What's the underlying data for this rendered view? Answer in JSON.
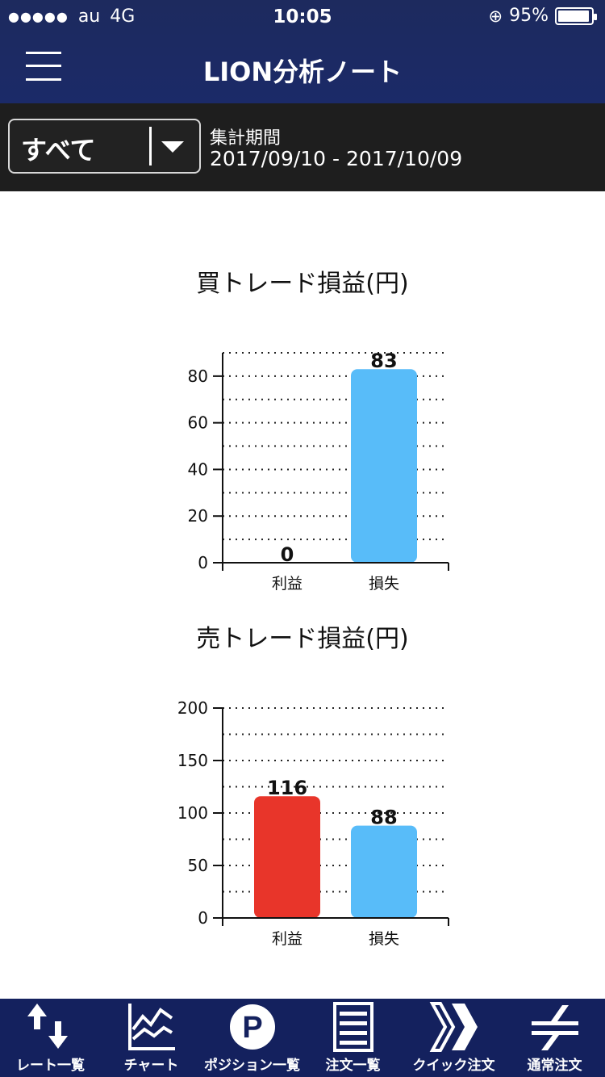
{
  "status_bar": {
    "signal": "●●●●●",
    "carrier": "au",
    "network": "4G",
    "time": "10:05",
    "battery": "95%"
  },
  "header": {
    "title": "LION分析ノート"
  },
  "filter": {
    "selected": "すべて",
    "period_label": "集計期間",
    "period_value": "2017/09/10 - 2017/10/09"
  },
  "chart_data": [
    {
      "type": "bar",
      "title": "買トレード損益(円)",
      "categories": [
        "利益",
        "損失"
      ],
      "values": [
        0,
        83
      ],
      "colors": [
        "#e8352a",
        "#58bcf9"
      ],
      "ylim": [
        0,
        90
      ],
      "yticks": [
        0,
        20,
        40,
        60,
        80
      ],
      "grid": true
    },
    {
      "type": "bar",
      "title": "売トレード損益(円)",
      "categories": [
        "利益",
        "損失"
      ],
      "values": [
        116,
        88
      ],
      "colors": [
        "#e8352a",
        "#58bcf9"
      ],
      "ylim": [
        0,
        200
      ],
      "yticks": [
        0,
        50,
        100,
        150,
        200
      ],
      "grid": true
    }
  ],
  "tabs": [
    {
      "label": "レート一覧",
      "icon": "rate-list-icon"
    },
    {
      "label": "チャート",
      "icon": "chart-icon"
    },
    {
      "label": "ポジション一覧",
      "icon": "position-icon"
    },
    {
      "label": "注文一覧",
      "icon": "order-list-icon"
    },
    {
      "label": "クイック注文",
      "icon": "quick-order-icon"
    },
    {
      "label": "通常注文",
      "icon": "normal-order-icon"
    }
  ]
}
